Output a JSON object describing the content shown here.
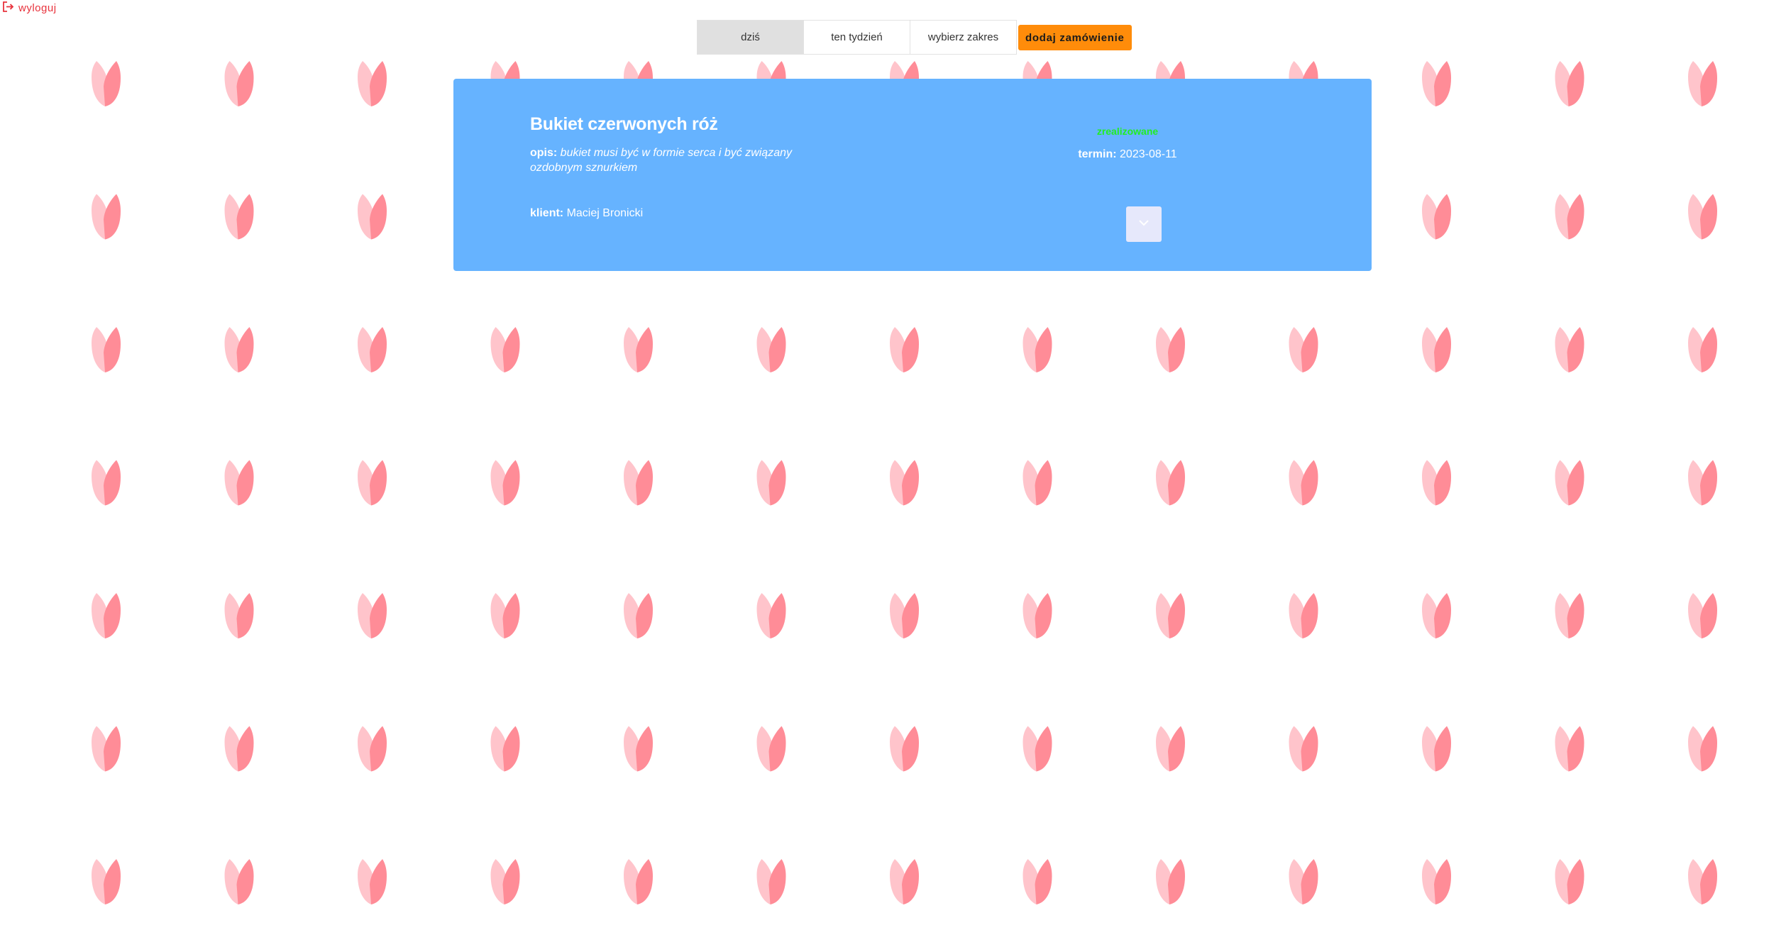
{
  "header": {
    "logout_label": "wyloguj",
    "logout_icon": "logout-icon"
  },
  "filters": {
    "items": [
      {
        "label": "dziś",
        "active": true
      },
      {
        "label": "ten tydzień",
        "active": false
      },
      {
        "label": "wybierz zakres",
        "active": false
      }
    ],
    "add_order_label": "dodaj zamówienie"
  },
  "order": {
    "title": "Bukiet czerwonych róż",
    "description_label": "opis:",
    "description": "bukiet musi być w formie serca i być związany ozdobnym sznurkiem",
    "client_label": "klient:",
    "client": "Maciej Bronicki",
    "status": "zrealizowane",
    "due_label": "termin:",
    "due_date": "2023-08-11",
    "expand_icon": "chevron-down-icon"
  },
  "colors": {
    "accent_orange": "#ff8c0a",
    "card_blue": "#66b3ff",
    "status_green": "#22ee22",
    "logout_red": "#e8323c",
    "petal_light": "#ffc4cb",
    "petal_dark": "#ff8c97"
  },
  "background": {
    "pattern_icon": "tulip-icon"
  }
}
